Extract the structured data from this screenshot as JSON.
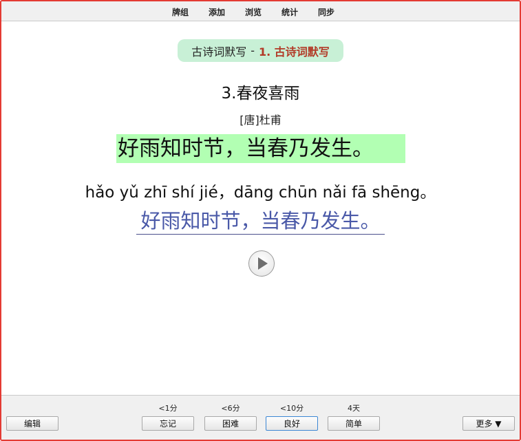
{
  "menu": {
    "items": [
      "牌组",
      "添加",
      "浏览",
      "统计",
      "同步"
    ]
  },
  "card": {
    "deck_name": "古诗词默写",
    "separator": "-",
    "subdeck_name": "1. 古诗词默写",
    "poem_title": "3.春夜喜雨",
    "author": "[唐]杜甫",
    "verse": "好雨知时节，当春乃发生。",
    "pinyin": "hǎo yǔ zhī shí jié，dāng chūn nǎi fā shēng。",
    "typed_answer": "好雨知时节，当春乃发生。",
    "play_icon": "play-icon"
  },
  "bottom": {
    "edit_label": "编辑",
    "more_label": "更多 ▼",
    "answers": [
      {
        "interval": "<1分",
        "label": "忘记"
      },
      {
        "interval": "<6分",
        "label": "困难"
      },
      {
        "interval": "<10分",
        "label": "良好"
      },
      {
        "interval": "4天",
        "label": "简单"
      }
    ]
  },
  "colors": {
    "frame_border": "#e43a33",
    "deck_pill_bg": "#c8f0d6",
    "subdeck_text": "#b23a27",
    "verse_highlight": "#b2ffb3",
    "answer_text": "#4a59a8"
  }
}
